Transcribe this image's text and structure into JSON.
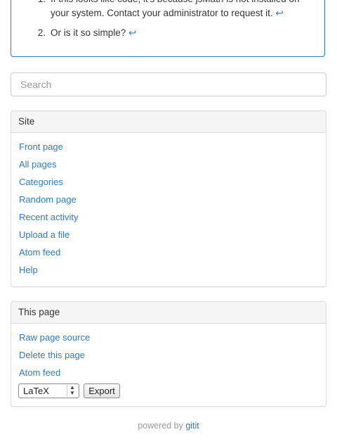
{
  "footnotes": {
    "items": [
      {
        "number": "1.",
        "text": "If this looks like code, it's because jsMath is not installed on your system. Contact your administrator to request it.",
        "backref": "↩"
      },
      {
        "number": "2.",
        "text": "Or is it so simple?",
        "backref": "↩"
      }
    ]
  },
  "search": {
    "placeholder": "Search",
    "value": ""
  },
  "site_panel": {
    "title": "Site",
    "links": [
      "Front page",
      "All pages",
      "Categories",
      "Random page",
      "Recent activity",
      "Upload a file",
      "Atom feed",
      "Help"
    ]
  },
  "page_panel": {
    "title": "This page",
    "links": [
      "Raw page source",
      "Delete this page",
      "Atom feed"
    ],
    "export_format": "LaTeX",
    "export_label": "Export"
  },
  "footer": {
    "prefix": "powered by",
    "link": "gitit"
  },
  "colors": {
    "link": "#337ab7",
    "panel_heading_bg": "#f5f5f5",
    "border": "#dddddd"
  }
}
